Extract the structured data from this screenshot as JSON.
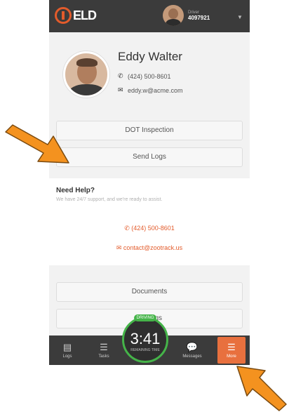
{
  "header": {
    "logo_text": "ELD",
    "user_label": "Driver",
    "user_id": "4097921"
  },
  "profile": {
    "name": "Eddy Walter",
    "phone": "(424) 500-8601",
    "email": "eddy.w@acme.com"
  },
  "menu": {
    "dot_inspection": "DOT Inspection",
    "send_logs": "Send Logs",
    "documents": "Documents",
    "settings": "Settings"
  },
  "help": {
    "title": "Need Help?",
    "subtitle": "We have 24/7 support, and we're ready to assist.",
    "phone": "(424) 500-8601",
    "email": "contact@zootrack.us"
  },
  "timer": {
    "status": "DRIVING",
    "time": "3:41",
    "label": "REMAINING TIME"
  },
  "tabs": {
    "logs": "Logs",
    "tasks": "Tasks",
    "messages": "Messages",
    "more": "More"
  },
  "colors": {
    "accent": "#e35b2b",
    "tab_active": "#e8703e",
    "status_green": "#45b449",
    "header_bg": "#3b3b3b",
    "arrow": "#f4921f"
  }
}
